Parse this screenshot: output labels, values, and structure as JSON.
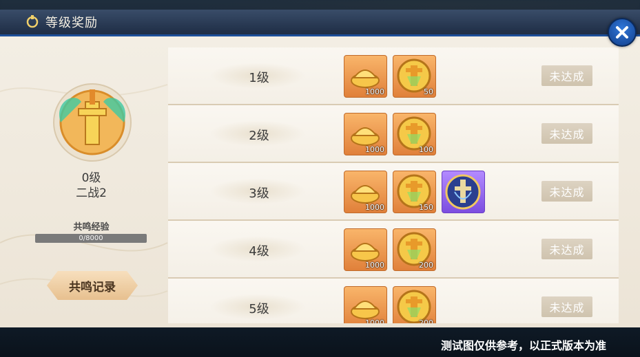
{
  "header": {
    "title": "等级奖励"
  },
  "profile": {
    "level": "0级",
    "name": "二战2",
    "exp_label": "共鸣经验",
    "exp_value": "0/8000",
    "exp_progress": 0,
    "record_button": "共鸣记录"
  },
  "rows": [
    {
      "level": "1级",
      "status": "未达成",
      "rewards": [
        {
          "icon": "gold-ingot-icon",
          "qty": "1000"
        },
        {
          "icon": "resonance-coin-icon",
          "qty": "50"
        }
      ]
    },
    {
      "level": "2级",
      "status": "未达成",
      "rewards": [
        {
          "icon": "gold-ingot-icon",
          "qty": "1000"
        },
        {
          "icon": "resonance-coin-icon",
          "qty": "100"
        }
      ]
    },
    {
      "level": "3级",
      "status": "未达成",
      "rewards": [
        {
          "icon": "gold-ingot-icon",
          "qty": "1000"
        },
        {
          "icon": "resonance-coin-icon",
          "qty": "150"
        },
        {
          "icon": "sword-emblem-icon",
          "qty": ""
        }
      ]
    },
    {
      "level": "4级",
      "status": "未达成",
      "rewards": [
        {
          "icon": "gold-ingot-icon",
          "qty": "1000"
        },
        {
          "icon": "resonance-coin-icon",
          "qty": "200"
        }
      ]
    },
    {
      "level": "5级",
      "status": "未达成",
      "rewards": [
        {
          "icon": "gold-ingot-icon",
          "qty": "1000"
        },
        {
          "icon": "resonance-coin-icon",
          "qty": "200"
        }
      ]
    }
  ],
  "footer": {
    "disclaimer": "测试图仅供参考，以正式版本为准"
  },
  "colors": {
    "accent_blue": "#1d4f9a",
    "item_orange": "#e0803a",
    "item_purple": "#7c4de0",
    "status_gray": "#cfc3ae"
  }
}
